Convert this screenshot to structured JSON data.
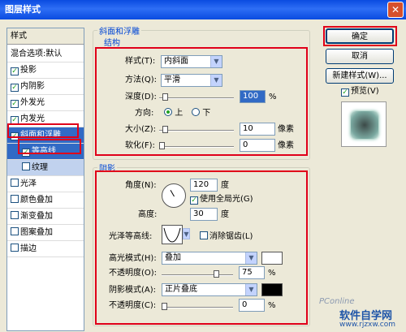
{
  "window": {
    "title": "图层样式"
  },
  "style_list": {
    "header": "样式",
    "items": [
      {
        "label": "混合选项:默认",
        "checkbox": false,
        "checked": false
      },
      {
        "label": "投影",
        "checkbox": true,
        "checked": true
      },
      {
        "label": "内阴影",
        "checkbox": true,
        "checked": true
      },
      {
        "label": "外发光",
        "checkbox": true,
        "checked": true
      },
      {
        "label": "内发光",
        "checkbox": true,
        "checked": true
      },
      {
        "label": "斜面和浮雕",
        "checkbox": true,
        "checked": true
      },
      {
        "label": "等高线",
        "checkbox": true,
        "checked": true
      },
      {
        "label": "纹理",
        "checkbox": true,
        "checked": false
      },
      {
        "label": "光泽",
        "checkbox": true,
        "checked": false
      },
      {
        "label": "颜色叠加",
        "checkbox": true,
        "checked": false
      },
      {
        "label": "渐变叠加",
        "checkbox": true,
        "checked": false
      },
      {
        "label": "图案叠加",
        "checkbox": true,
        "checked": false
      },
      {
        "label": "描边",
        "checkbox": true,
        "checked": false
      }
    ]
  },
  "buttons": {
    "ok": "确定",
    "cancel": "取消",
    "new_style": "新建样式(W)...",
    "preview": "预览(V)"
  },
  "bevel": {
    "title": "斜面和浮雕",
    "structure": {
      "title": "结构",
      "style_label": "样式(T):",
      "style_value": "内斜面",
      "technique_label": "方法(Q):",
      "technique_value": "平滑",
      "depth_label": "深度(D):",
      "depth_value": "100",
      "depth_unit": "%",
      "direction_label": "方向:",
      "direction_up": "上",
      "direction_down": "下",
      "size_label": "大小(Z):",
      "size_value": "10",
      "size_unit": "像素",
      "soften_label": "软化(F):",
      "soften_value": "0",
      "soften_unit": "像素"
    },
    "shading": {
      "title": "阴影",
      "angle_label": "角度(N):",
      "angle_value": "120",
      "angle_unit": "度",
      "global_light": "使用全局光(G)",
      "altitude_label": "高度:",
      "altitude_value": "30",
      "altitude_unit": "度",
      "gloss_label": "光泽等高线:",
      "anti_alias": "消除锯齿(L)",
      "highlight_label": "高光模式(H):",
      "highlight_value": "叠加",
      "highlight_opacity_label": "不透明度(O):",
      "highlight_opacity_value": "75",
      "highlight_opacity_unit": "%",
      "shadow_label": "阴影模式(A):",
      "shadow_value": "正片叠底",
      "shadow_opacity_label": "不透明度(C):",
      "shadow_opacity_value": "0",
      "shadow_opacity_unit": "%",
      "highlight_color": "#ffffff",
      "shadow_color": "#000000"
    }
  },
  "watermark": {
    "brand": "PConline",
    "site": "软件自学网",
    "url": "www.rjzxw.com"
  }
}
